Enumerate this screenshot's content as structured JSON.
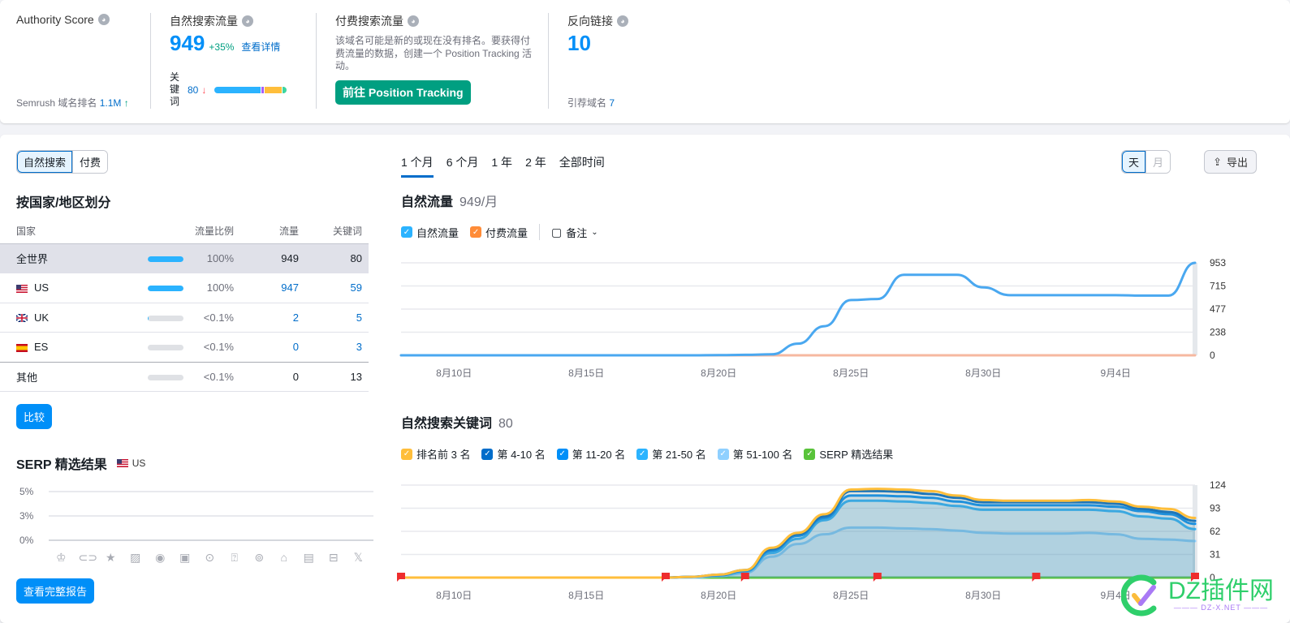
{
  "overview": {
    "authority": {
      "title": "Authority Score",
      "rank_label": "Semrush 域名排名",
      "rank_value": "1.1M",
      "rank_trend": "↑"
    },
    "organic": {
      "title": "自然搜索流量",
      "value": "949",
      "change": "+35%",
      "details_link": "查看详情",
      "keywords_label": "关键词",
      "keywords_value": "80",
      "keywords_trend": "↓",
      "distribution": [
        {
          "name": "top-positions",
          "share": 0.62,
          "color": "#2bb3ff"
        },
        {
          "name": "serp",
          "share": 0.03,
          "color": "#a75ef9"
        },
        {
          "name": "positions-mid",
          "share": 0.24,
          "color": "#ffbe3b"
        },
        {
          "name": "positions-low",
          "share": 0.05,
          "color": "#3dd6a0"
        }
      ]
    },
    "paid": {
      "title": "付费搜索流量",
      "description": "该域名可能是新的或现在没有排名。要获得付费流量的数据，创建一个 Position Tracking 活动。",
      "cta": "前往 Position Tracking"
    },
    "backlinks": {
      "title": "反向链接",
      "value": "10",
      "ref_domains_label": "引荐域名",
      "ref_domains_value": "7"
    }
  },
  "left": {
    "segment": [
      "自然搜索",
      "付费"
    ],
    "section_title": "按国家/地区划分",
    "columns": [
      "国家",
      "流量比例",
      "流量",
      "关键词"
    ],
    "rows": [
      {
        "country": "全世界",
        "flag": "",
        "share_text": "100%",
        "share": 1.0,
        "traffic": "949",
        "keywords": "80"
      },
      {
        "country": "US",
        "flag": "us",
        "share_text": "100%",
        "share": 1.0,
        "traffic": "947",
        "keywords": "59"
      },
      {
        "country": "UK",
        "flag": "uk",
        "share_text": "<0.1%",
        "share": 0.02,
        "traffic": "2",
        "keywords": "5"
      },
      {
        "country": "ES",
        "flag": "es",
        "share_text": "<0.1%",
        "share": 0.0,
        "traffic": "0",
        "keywords": "3"
      },
      {
        "country": "其他",
        "flag": "",
        "share_text": "<0.1%",
        "share": 0.0,
        "traffic": "0",
        "keywords": "13"
      }
    ],
    "compare_btn": "比较",
    "serp_title": "SERP 精选结果",
    "serp_country": "US",
    "serp_yticks": [
      "5%",
      "3%",
      "0%"
    ],
    "serp_icons": [
      "crown-icon",
      "link-icon",
      "star-icon",
      "image-icon",
      "video-icon",
      "video-carousel-icon",
      "play-icon",
      "faq-icon",
      "location-icon",
      "scholar-icon",
      "news-icon",
      "jobs-icon",
      "x-icon"
    ],
    "full_report_btn": "查看完整报告"
  },
  "right": {
    "period_tabs": [
      "1 个月",
      "6 个月",
      "1 年",
      "2 年",
      "全部时间"
    ],
    "granularity": [
      "天",
      "月"
    ],
    "export": "导出",
    "traffic_title": "自然流量",
    "traffic_value": "949/月",
    "traffic_legend": [
      {
        "label": "自然流量",
        "color": "#2bb3ff"
      },
      {
        "label": "付费流量",
        "color": "#ff8c38"
      }
    ],
    "notes_label": "备注",
    "kw_title": "自然搜索关键词",
    "kw_value": "80",
    "kw_legend": [
      {
        "label": "排名前 3 名",
        "color": "#ffbe3b"
      },
      {
        "label": "第 4-10 名",
        "color": "#006dca"
      },
      {
        "label": "第 11-20 名",
        "color": "#008ff8"
      },
      {
        "label": "第 21-50 名",
        "color": "#2bb3ff"
      },
      {
        "label": "第 51-100 名",
        "color": "#8fd0ff"
      },
      {
        "label": "SERP 精选结果",
        "color": "#59c33a"
      }
    ]
  },
  "chart_data": [
    {
      "type": "line",
      "title": "自然流量",
      "x": [
        "8月8日",
        "8月9日",
        "8月10日",
        "8月11日",
        "8月12日",
        "8月13日",
        "8月14日",
        "8月15日",
        "8月16日",
        "8月17日",
        "8月18日",
        "8月19日",
        "8月20日",
        "8月21日",
        "8月22日",
        "8月23日",
        "8月24日",
        "8月25日",
        "8月26日",
        "8月27日",
        "8月28日",
        "8月29日",
        "8月30日",
        "8月31日",
        "9月1日",
        "9月2日",
        "9月3日",
        "9月4日",
        "9月5日",
        "9月6日",
        "9月7日"
      ],
      "xticks": [
        "8月10日",
        "8月15日",
        "8月20日",
        "8月25日",
        "8月30日",
        "9月4日"
      ],
      "yticks": [
        0,
        238,
        477,
        715,
        953
      ],
      "ylim": [
        0,
        953
      ],
      "series": [
        {
          "name": "自然流量",
          "color": "#4aa8f0",
          "values": [
            0,
            0,
            0,
            0,
            0,
            0,
            0,
            0,
            0,
            0,
            0,
            0,
            2,
            5,
            10,
            120,
            300,
            570,
            580,
            830,
            830,
            830,
            700,
            620,
            620,
            620,
            620,
            620,
            615,
            615,
            953
          ]
        },
        {
          "name": "付费流量",
          "color": "#f6b8a0",
          "values": [
            0,
            0,
            0,
            0,
            0,
            0,
            0,
            0,
            0,
            0,
            0,
            0,
            0,
            0,
            0,
            0,
            0,
            0,
            0,
            0,
            0,
            0,
            0,
            0,
            0,
            0,
            0,
            0,
            0,
            0,
            0
          ]
        }
      ],
      "grid": true
    },
    {
      "type": "area",
      "title": "自然搜索关键词",
      "x": [
        "8月8日",
        "8月9日",
        "8月10日",
        "8月11日",
        "8月12日",
        "8月13日",
        "8月14日",
        "8月15日",
        "8月16日",
        "8月17日",
        "8月18日",
        "8月19日",
        "8月20日",
        "8月21日",
        "8月22日",
        "8月23日",
        "8月24日",
        "8月25日",
        "8月26日",
        "8月27日",
        "8月28日",
        "8月29日",
        "8月30日",
        "8月31日",
        "9月1日",
        "9月2日",
        "9月3日",
        "9月4日",
        "9月5日",
        "9月6日",
        "9月7日"
      ],
      "xticks": [
        "8月10日",
        "8月15日",
        "8月20日",
        "8月25日",
        "8月30日",
        "9月4日"
      ],
      "yticks": [
        0,
        31,
        62,
        93,
        124
      ],
      "ylim": [
        0,
        124
      ],
      "series": [
        {
          "name": "排名前 3 名",
          "color": "#ffbe3b",
          "values": [
            0,
            0,
            0,
            0,
            0,
            0,
            0,
            0,
            0,
            0,
            0,
            1,
            4,
            10,
            40,
            60,
            85,
            118,
            119,
            118,
            116,
            110,
            104,
            103,
            103,
            103,
            104,
            102,
            95,
            92,
            80
          ]
        },
        {
          "name": "第 4-10 名",
          "color": "#006dca",
          "values": [
            0,
            0,
            0,
            0,
            0,
            0,
            0,
            0,
            0,
            0,
            0,
            1,
            4,
            10,
            38,
            58,
            82,
            116,
            116,
            115,
            112,
            107,
            101,
            101,
            101,
            101,
            101,
            99,
            92,
            88,
            76
          ]
        },
        {
          "name": "第 11-20 名",
          "color": "#008ff8",
          "values": [
            0,
            0,
            0,
            0,
            0,
            0,
            0,
            0,
            0,
            0,
            0,
            1,
            3,
            9,
            36,
            56,
            80,
            110,
            110,
            109,
            107,
            102,
            97,
            97,
            97,
            97,
            97,
            95,
            89,
            85,
            72
          ]
        },
        {
          "name": "第 21-50 名",
          "color": "#2bb3ff",
          "values": [
            0,
            0,
            0,
            0,
            0,
            0,
            0,
            0,
            0,
            0,
            0,
            1,
            3,
            8,
            33,
            52,
            77,
            103,
            103,
            102,
            100,
            96,
            91,
            91,
            91,
            91,
            91,
            89,
            82,
            79,
            65
          ]
        },
        {
          "name": "第 51-100 名",
          "color": "#8fd0ff",
          "values": [
            0,
            0,
            0,
            0,
            0,
            0,
            0,
            0,
            0,
            0,
            0,
            0,
            2,
            6,
            28,
            45,
            58,
            67,
            67,
            66,
            65,
            63,
            60,
            59,
            59,
            59,
            60,
            58,
            52,
            51,
            49
          ]
        },
        {
          "name": "SERP 精选结果",
          "color": "#59c33a",
          "values": [
            0,
            0,
            0,
            0,
            0,
            0,
            0,
            0,
            0,
            0,
            0,
            0,
            0,
            0,
            0,
            0,
            0,
            0,
            0,
            0,
            0,
            0,
            0,
            0,
            0,
            0,
            0,
            0,
            0,
            0,
            0
          ]
        }
      ],
      "notes_x": [
        "8月8日",
        "8月18日",
        "8月21日",
        "8月26日",
        "9月1日",
        "9月7日"
      ],
      "grid": true
    }
  ]
}
